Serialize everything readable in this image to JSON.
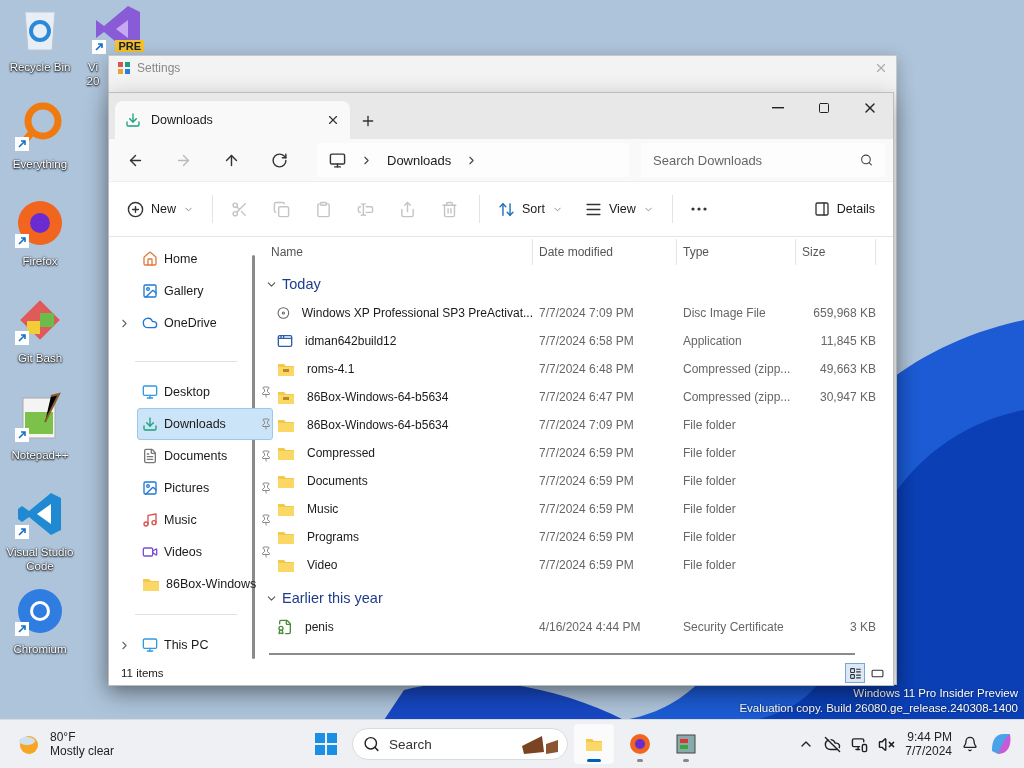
{
  "desktop_icons": [
    {
      "label": "Recycle Bin",
      "kind": "recycle",
      "shortcut": false
    },
    {
      "label": "Everything",
      "kind": "everything",
      "shortcut": true
    },
    {
      "label": "Firefox",
      "kind": "firefox",
      "shortcut": true
    },
    {
      "label": "Git Bash",
      "kind": "git",
      "shortcut": true
    },
    {
      "label": "Notepad++",
      "kind": "notepad",
      "shortcut": true
    },
    {
      "label": "Visual Studio Code",
      "kind": "vscode",
      "shortcut": true
    },
    {
      "label": "Chromium",
      "kind": "chromium",
      "shortcut": true
    },
    {
      "label": "Vi 20",
      "kind": "vs",
      "shortcut": true,
      "badge": "PRE"
    }
  ],
  "settings_window": {
    "title": "Settings"
  },
  "explorer": {
    "tabs": [
      {
        "label": "Downloads",
        "selected": true
      }
    ],
    "nav": [
      {
        "kind": "back",
        "disabled": false
      },
      {
        "kind": "forward",
        "disabled": true
      },
      {
        "kind": "up",
        "disabled": false
      },
      {
        "kind": "refresh",
        "disabled": false
      }
    ],
    "breadcrumbs": [
      "Downloads"
    ],
    "search": {
      "placeholder": "Search Downloads"
    },
    "commands": [
      {
        "kind": "new",
        "label": "New",
        "disabled": false
      },
      {
        "kind": "cut",
        "disabled": true
      },
      {
        "kind": "copy",
        "disabled": true
      },
      {
        "kind": "paste",
        "disabled": true
      },
      {
        "kind": "rename",
        "disabled": true
      },
      {
        "kind": "share",
        "disabled": true
      },
      {
        "kind": "delete",
        "disabled": true
      },
      {
        "kind": "sort",
        "label": "Sort",
        "disabled": false
      },
      {
        "kind": "view",
        "label": "View",
        "disabled": false
      },
      {
        "kind": "more",
        "disabled": false
      }
    ],
    "details_button": {
      "label": "Details"
    },
    "sidebar": [
      [
        {
          "label": "Home",
          "kind": "home",
          "selected": false,
          "expandable": false,
          "pinned": false
        },
        {
          "label": "Gallery",
          "kind": "gallery",
          "selected": false,
          "expandable": false,
          "pinned": false
        },
        {
          "label": "OneDrive",
          "kind": "cloud",
          "selected": false,
          "expandable": true,
          "pinned": false
        }
      ],
      [
        {
          "label": "Desktop",
          "kind": "desktop",
          "selected": false,
          "expandable": false,
          "pinned": true
        },
        {
          "label": "Downloads",
          "kind": "download",
          "selected": true,
          "expandable": false,
          "pinned": true
        },
        {
          "label": "Documents",
          "kind": "document",
          "selected": false,
          "expandable": false,
          "pinned": true
        },
        {
          "label": "Pictures",
          "kind": "picture",
          "selected": false,
          "expandable": false,
          "pinned": true
        },
        {
          "label": "Music",
          "kind": "music",
          "selected": false,
          "expandable": false,
          "pinned": true
        },
        {
          "label": "Videos",
          "kind": "video",
          "selected": false,
          "expandable": false,
          "pinned": true
        },
        {
          "label": "86Box-Windows",
          "kind": "folder",
          "selected": false,
          "expandable": false,
          "pinned": false
        }
      ],
      [
        {
          "label": "This PC",
          "kind": "pc",
          "selected": false,
          "expandable": true,
          "pinned": false
        }
      ]
    ],
    "columns": [
      "Name",
      "Date modified",
      "Type",
      "Size"
    ],
    "groups": [
      {
        "label": "Today",
        "expanded": true,
        "rows": [
          {
            "kind": "disc",
            "name": "Windows XP Professional SP3 PreActivat...",
            "date": "7/7/2024 7:09 PM",
            "type": "Disc Image File",
            "size": "659,968 KB"
          },
          {
            "kind": "app",
            "name": "idman642build12",
            "date": "7/7/2024 6:58 PM",
            "type": "Application",
            "size": "11,845 KB"
          },
          {
            "kind": "zip",
            "name": "roms-4.1",
            "date": "7/7/2024 6:48 PM",
            "type": "Compressed (zipp...",
            "size": "49,663 KB"
          },
          {
            "kind": "zip",
            "name": "86Box-Windows-64-b5634",
            "date": "7/7/2024 6:47 PM",
            "type": "Compressed (zipp...",
            "size": "30,947 KB"
          },
          {
            "kind": "folder",
            "name": "86Box-Windows-64-b5634",
            "date": "7/7/2024 7:09 PM",
            "type": "File folder"
          },
          {
            "kind": "folder",
            "name": "Compressed",
            "date": "7/7/2024 6:59 PM",
            "type": "File folder"
          },
          {
            "kind": "folder",
            "name": "Documents",
            "date": "7/7/2024 6:59 PM",
            "type": "File folder"
          },
          {
            "kind": "folder",
            "name": "Music",
            "date": "7/7/2024 6:59 PM",
            "type": "File folder"
          },
          {
            "kind": "folder",
            "name": "Programs",
            "date": "7/7/2024 6:59 PM",
            "type": "File folder"
          },
          {
            "kind": "folder",
            "name": "Video",
            "date": "7/7/2024 6:59 PM",
            "type": "File folder"
          }
        ]
      },
      {
        "label": "Earlier this year",
        "expanded": true,
        "rows": [
          {
            "kind": "cert",
            "name": "penis",
            "date": "4/16/2024 4:44 PM",
            "type": "Security Certificate",
            "size": "3 KB"
          }
        ]
      }
    ],
    "status": "11 items",
    "views": [
      {
        "kind": "details",
        "selected": true
      },
      {
        "kind": "tiles",
        "selected": false
      }
    ]
  },
  "watermark": [
    "Windows 11 Pro Insider Preview",
    "Evaluation copy. Build 26080.ge_release.240308-1400"
  ],
  "taskbar": {
    "weather": {
      "temp": "80°F",
      "text": "Mostly clear"
    },
    "search": {
      "placeholder": "Search"
    },
    "apps": [
      {
        "kind": "explorer",
        "active": true
      },
      {
        "kind": "firefox",
        "active": false
      },
      {
        "kind": "app",
        "active": false
      }
    ],
    "time": "9:44 PM",
    "date": "7/7/2024"
  }
}
